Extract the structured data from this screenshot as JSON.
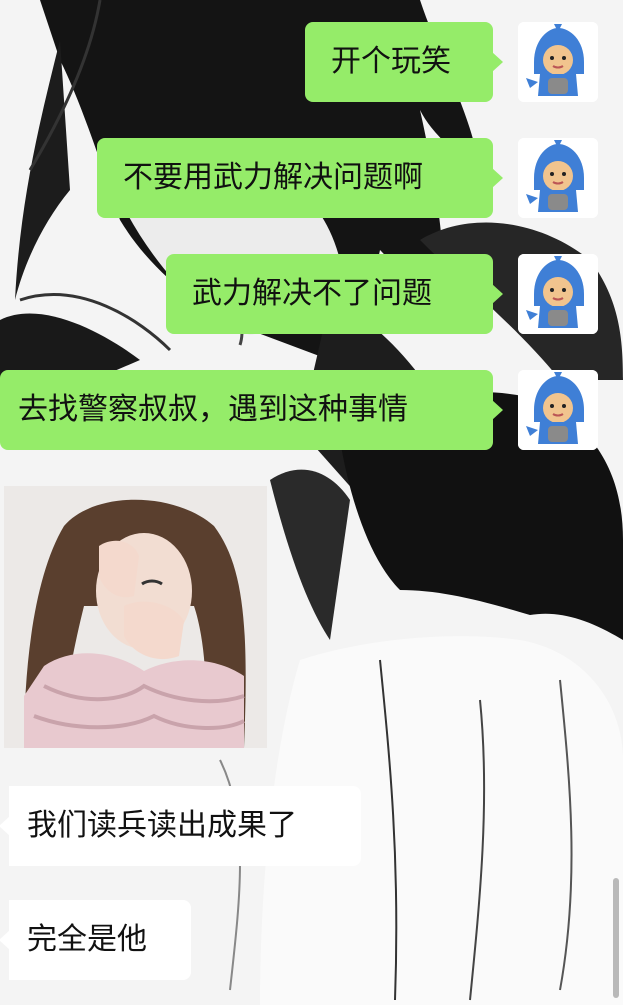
{
  "chat": {
    "messages": [
      {
        "side": "sent",
        "text": "开个玩笑"
      },
      {
        "side": "sent",
        "text": "不要用武力解决问题啊"
      },
      {
        "side": "sent",
        "text": "武力解决不了问题"
      },
      {
        "side": "sent",
        "text": "去找警察叔叔，遇到这种事情"
      },
      {
        "side": "received",
        "type": "sticker",
        "icon": "crying-girl-sticker"
      },
      {
        "side": "received",
        "text": "我们读兵读出成果了"
      },
      {
        "side": "received",
        "text": "完全是他"
      }
    ]
  },
  "colors": {
    "sent_bubble": "#95ec69",
    "received_bubble": "#ffffff",
    "avatar_shark": "#3f7fd6"
  },
  "icons": {
    "self_avatar": "shark-hoodie-avatar-icon"
  }
}
